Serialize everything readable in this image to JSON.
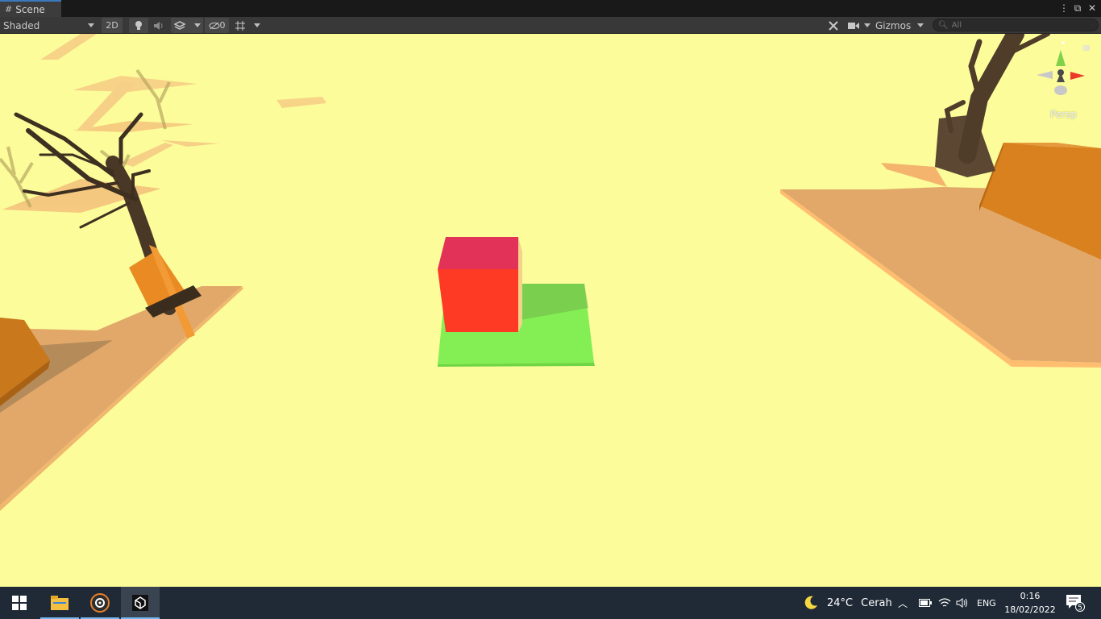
{
  "window": {
    "tab_label": "Scene",
    "controls": [
      "more-icon",
      "maximize-icon",
      "close-icon"
    ]
  },
  "toolbar": {
    "shading_mode": "Shaded",
    "mode_2d_label": "2D",
    "hidden_count": "0",
    "gizmos_label": "Gizmos",
    "search_placeholder": "All"
  },
  "viewport": {
    "projection_label": "Persp",
    "background_color": "#fcfc9a",
    "objects": {
      "cube_color": "#ff3a24",
      "cube_top_color": "#e33257",
      "ground_tile_color": "#84ee55",
      "platform_color": "#e2a86a"
    }
  },
  "taskbar": {
    "pinned": [
      "file-explorer-icon",
      "media-player-icon",
      "unity-icon"
    ],
    "weather_temp": "24°C",
    "weather_desc": "Cerah",
    "language": "ENG",
    "time": "0:16",
    "date": "18/02/2022",
    "notification_count": "5"
  }
}
